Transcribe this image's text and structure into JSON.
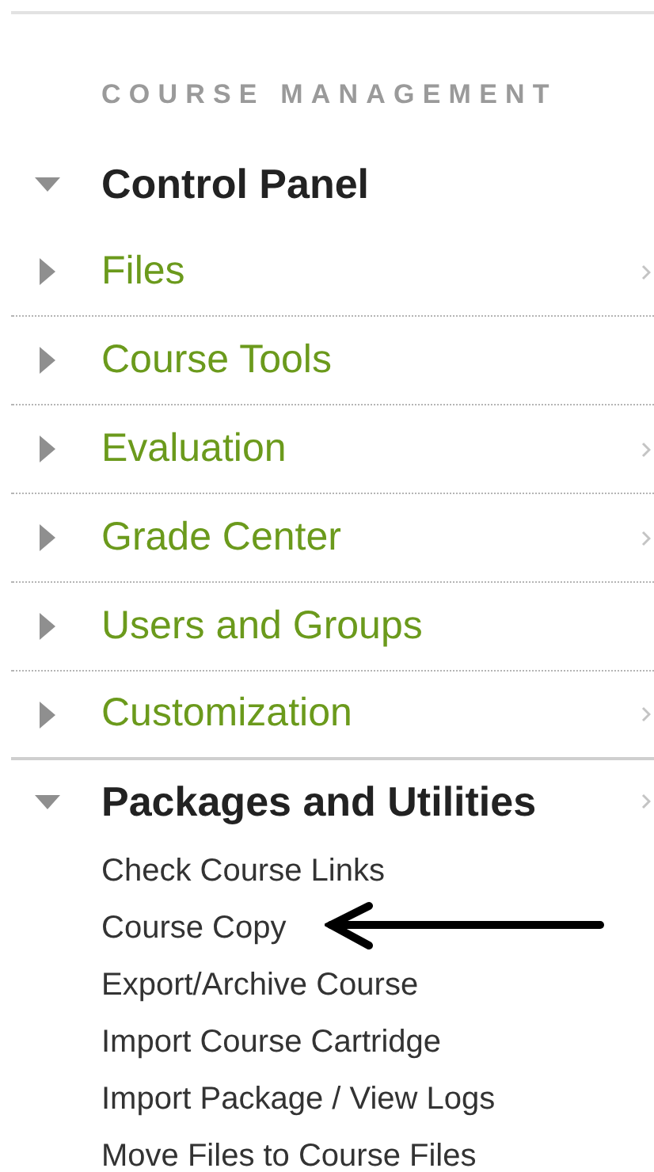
{
  "section_heading": "COURSE MANAGEMENT",
  "menu": [
    {
      "label": "Control Panel",
      "kind": "header",
      "expanded": true,
      "has_chevron": false
    },
    {
      "label": "Files",
      "kind": "link",
      "expanded": false,
      "has_chevron": true
    },
    {
      "label": "Course Tools",
      "kind": "link",
      "expanded": false,
      "has_chevron": false
    },
    {
      "label": "Evaluation",
      "kind": "link",
      "expanded": false,
      "has_chevron": true
    },
    {
      "label": "Grade Center",
      "kind": "link",
      "expanded": false,
      "has_chevron": true
    },
    {
      "label": "Users and Groups",
      "kind": "link",
      "expanded": false,
      "has_chevron": false
    },
    {
      "label": "Customization",
      "kind": "link",
      "expanded": false,
      "has_chevron": true
    },
    {
      "label": "Packages and Utilities",
      "kind": "header",
      "expanded": true,
      "has_chevron": true,
      "children": [
        {
          "label": "Check Course Links",
          "pointed": false
        },
        {
          "label": "Course Copy",
          "pointed": true
        },
        {
          "label": "Export/Archive Course",
          "pointed": false
        },
        {
          "label": "Import Course Cartridge",
          "pointed": false
        },
        {
          "label": "Import Package / View Logs",
          "pointed": false
        },
        {
          "label": "Move Files to Course Files",
          "pointed": false
        }
      ]
    }
  ]
}
